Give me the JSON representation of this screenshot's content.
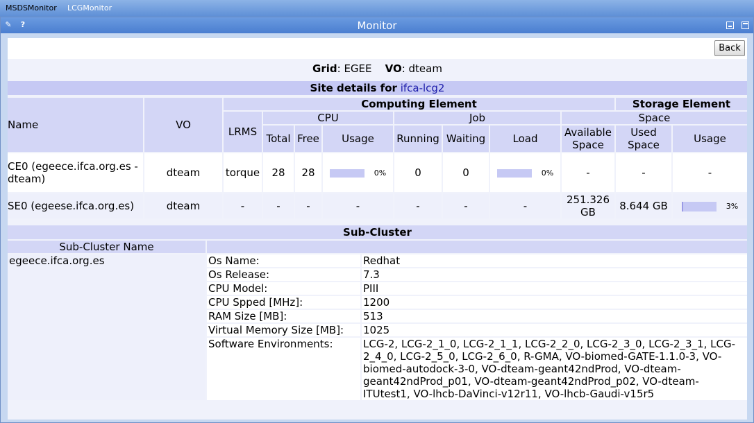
{
  "tabs": {
    "msds": "MSDSMonitor",
    "lcg": "LCGMonitor"
  },
  "portlet": {
    "title": "Monitor",
    "edit_icon": "✎",
    "help_icon": "?"
  },
  "back_label": "Back",
  "grid": {
    "grid_label": "Grid",
    "grid_value": "EGEE",
    "vo_label": "VO",
    "vo_value": "dteam"
  },
  "site": {
    "prefix": "Site details for",
    "name": "ifca-lcg2"
  },
  "headers": {
    "name": "Name",
    "vo": "VO",
    "computing": "Computing Element",
    "storage": "Storage Element",
    "lrms": "LRMS",
    "cpu": "CPU",
    "job": "Job",
    "space": "Space",
    "total": "Total",
    "free": "Free",
    "usage": "Usage",
    "running": "Running",
    "waiting": "Waiting",
    "load": "Load",
    "available": "Available Space",
    "used": "Used Space",
    "s_usage": "Usage"
  },
  "rows": [
    {
      "name": "CE0 (egeece.ifca.org.es - dteam)",
      "vo": "dteam",
      "lrms": "torque",
      "total": "28",
      "free": "28",
      "usage": "0%",
      "running": "0",
      "waiting": "0",
      "load": "0%",
      "available": "-",
      "used": "-",
      "s_usage": "-"
    },
    {
      "name": "SE0 (egeese.ifca.org.es)",
      "vo": "dteam",
      "lrms": "-",
      "total": "-",
      "free": "-",
      "usage": "-",
      "running": "-",
      "waiting": "-",
      "load": "-",
      "available": "251.326 GB",
      "used": "8.644 GB",
      "s_usage": "3%"
    }
  ],
  "subcluster": {
    "title": "Sub-Cluster",
    "name_header": "Sub-Cluster Name",
    "name": "egeece.ifca.org.es",
    "props": [
      {
        "k": "Os Name:",
        "v": "Redhat"
      },
      {
        "k": "Os Release:",
        "v": "7.3"
      },
      {
        "k": "CPU Model:",
        "v": "PIII"
      },
      {
        "k": "CPU Spped [MHz]:",
        "v": "1200"
      },
      {
        "k": "RAM Size [MB]:",
        "v": "513"
      },
      {
        "k": "Virtual Memory Size [MB]:",
        "v": "1025"
      },
      {
        "k": "Software Environments:",
        "v": "LCG-2, LCG-2_1_0, LCG-2_1_1, LCG-2_2_0, LCG-2_3_0, LCG-2_3_1, LCG-2_4_0, LCG-2_5_0, LCG-2_6_0, R-GMA, VO-biomed-GATE-1.1.0-3, VO-biomed-autodock-3-0, VO-dteam-geant42ndProd, VO-dteam-geant42ndProd_p01, VO-dteam-geant42ndProd_p02, VO-dteam-ITUtest1, VO-lhcb-DaVinci-v12r11, VO-lhcb-Gaudi-v15r5"
      }
    ]
  }
}
